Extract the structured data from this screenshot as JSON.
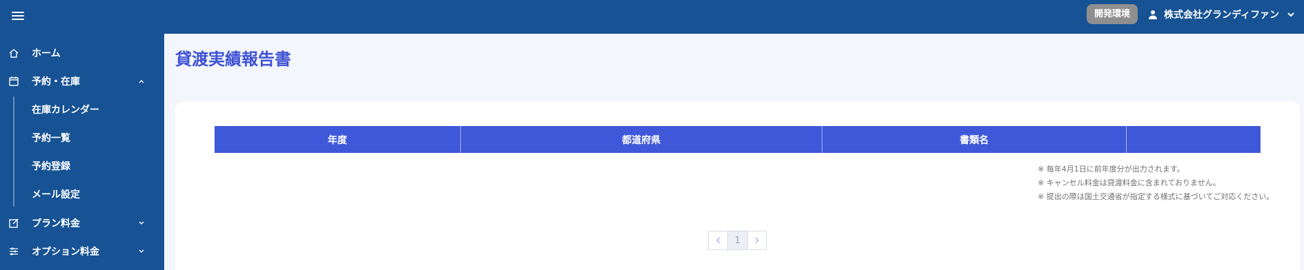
{
  "header": {
    "menu_icon": "hamburger-icon",
    "env_badge": "開発環境",
    "user_icon": "person-icon",
    "company_name": "株式会社グランディファン"
  },
  "sidebar": {
    "items": [
      {
        "label": "ホーム",
        "icon": "home-icon"
      },
      {
        "label": "予約・在庫",
        "icon": "calendar-icon",
        "expanded": true
      },
      {
        "label": "在庫カレンダー"
      },
      {
        "label": "予約一覧"
      },
      {
        "label": "予約登録"
      },
      {
        "label": "メール設定"
      },
      {
        "label": "プラン料金",
        "icon": "edit-icon",
        "expanded": false
      },
      {
        "label": "オプション料金",
        "icon": "sliders-icon",
        "expanded": false
      }
    ]
  },
  "main": {
    "title": "貸渡実績報告書",
    "table": {
      "columns": [
        "年度",
        "都道府県",
        "書類名",
        ""
      ]
    },
    "notes": [
      "※ 毎年4月1日に前年度分が出力されます。",
      "※ キャンセル料金は貸渡料金に含まれておりません。",
      "※ 提出の際は国土交通省が指定する様式に基づいてご対応ください。"
    ],
    "pagination": {
      "current_page": "1"
    }
  },
  "colors": {
    "header_bg": "#165294",
    "accent": "#3f58d9",
    "title": "#3f51d3",
    "badge_bg": "#8f8f8f"
  }
}
